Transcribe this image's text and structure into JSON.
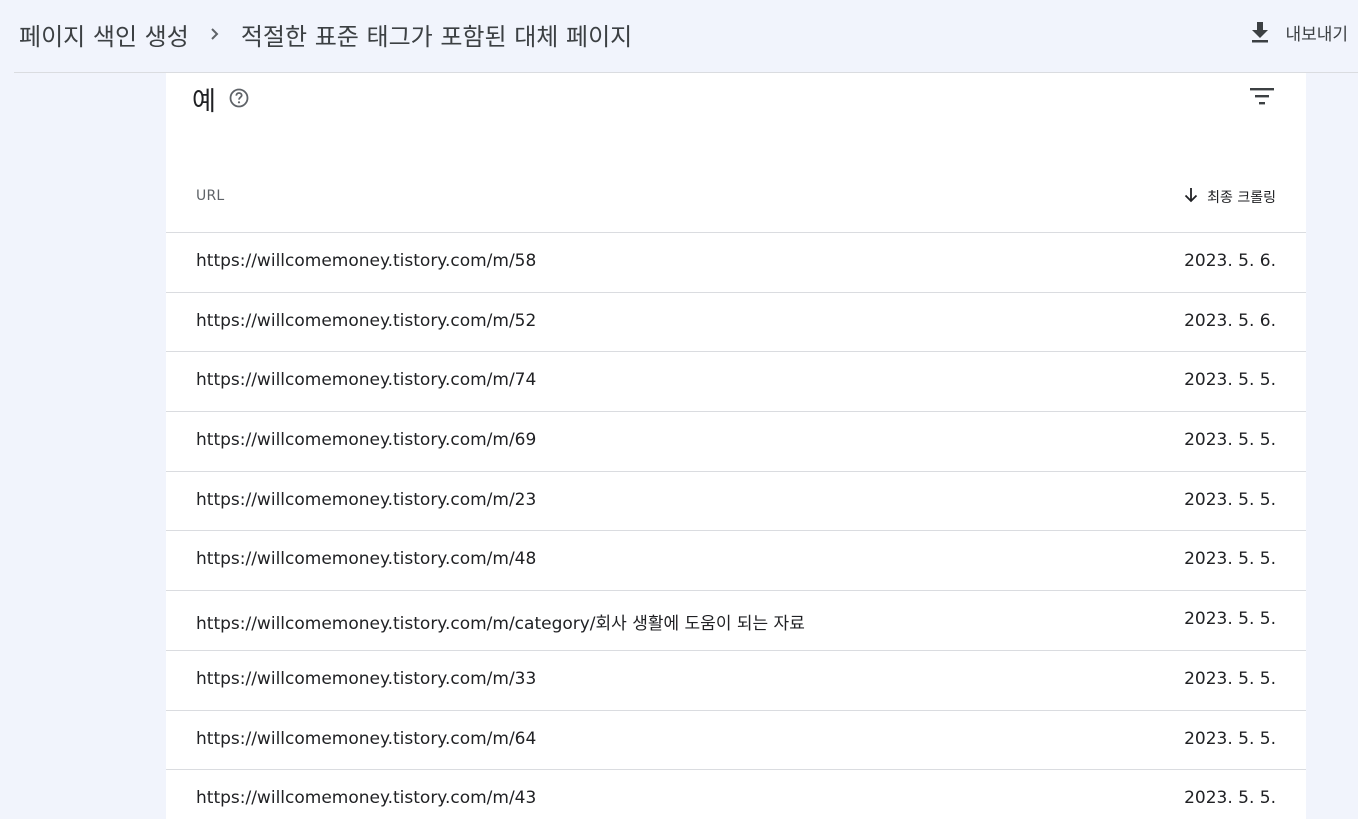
{
  "header": {
    "breadcrumb": [
      "페이지 색인 생성",
      "적절한 표준 태그가 포함된 대체 페이지"
    ],
    "export_label": "내보내기"
  },
  "card": {
    "title": "예",
    "columns": {
      "url": "URL",
      "last_crawled": "최종 크롤링"
    },
    "rows": [
      {
        "url": "https://willcomemoney.tistory.com/m/58",
        "date": "2023. 5. 6."
      },
      {
        "url": "https://willcomemoney.tistory.com/m/52",
        "date": "2023. 5. 6."
      },
      {
        "url": "https://willcomemoney.tistory.com/m/74",
        "date": "2023. 5. 5."
      },
      {
        "url": "https://willcomemoney.tistory.com/m/69",
        "date": "2023. 5. 5."
      },
      {
        "url": "https://willcomemoney.tistory.com/m/23",
        "date": "2023. 5. 5."
      },
      {
        "url": "https://willcomemoney.tistory.com/m/48",
        "date": "2023. 5. 5."
      },
      {
        "url": "https://willcomemoney.tistory.com/m/category/회사 생활에 도움이 되는 자료",
        "date": "2023. 5. 5."
      },
      {
        "url": "https://willcomemoney.tistory.com/m/33",
        "date": "2023. 5. 5."
      },
      {
        "url": "https://willcomemoney.tistory.com/m/64",
        "date": "2023. 5. 5."
      },
      {
        "url": "https://willcomemoney.tistory.com/m/43",
        "date": "2023. 5. 5."
      }
    ]
  },
  "icons": {
    "separator": "chevron-right-icon",
    "export": "download-icon",
    "help": "help-circle-icon",
    "filter": "filter-icon",
    "sort": "arrow-down-icon"
  },
  "colors": {
    "page_background": "#f1f4fc",
    "card_background": "#ffffff",
    "divider": "#dadce0",
    "text": "#202124"
  }
}
